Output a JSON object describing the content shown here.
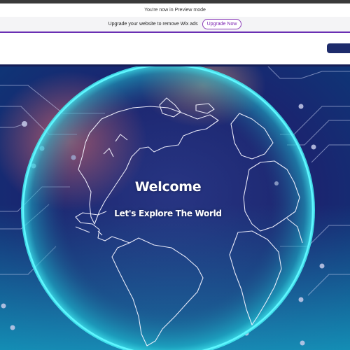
{
  "preview_bar": {
    "text": "You're now in Preview mode"
  },
  "upgrade_bar": {
    "text": "Upgrade your website to remove Wix ads",
    "button_label": "Upgrade Now"
  },
  "hero": {
    "title": "Welcome",
    "subtitle": "Let's Explore The World"
  },
  "colors": {
    "upgrade_accent": "#7a1fb0",
    "header_button": "#1d2b6b",
    "hero_dark": "#1a1f5e",
    "hero_glow": "#2ee6f0",
    "globe_lines": "#ffffff"
  }
}
